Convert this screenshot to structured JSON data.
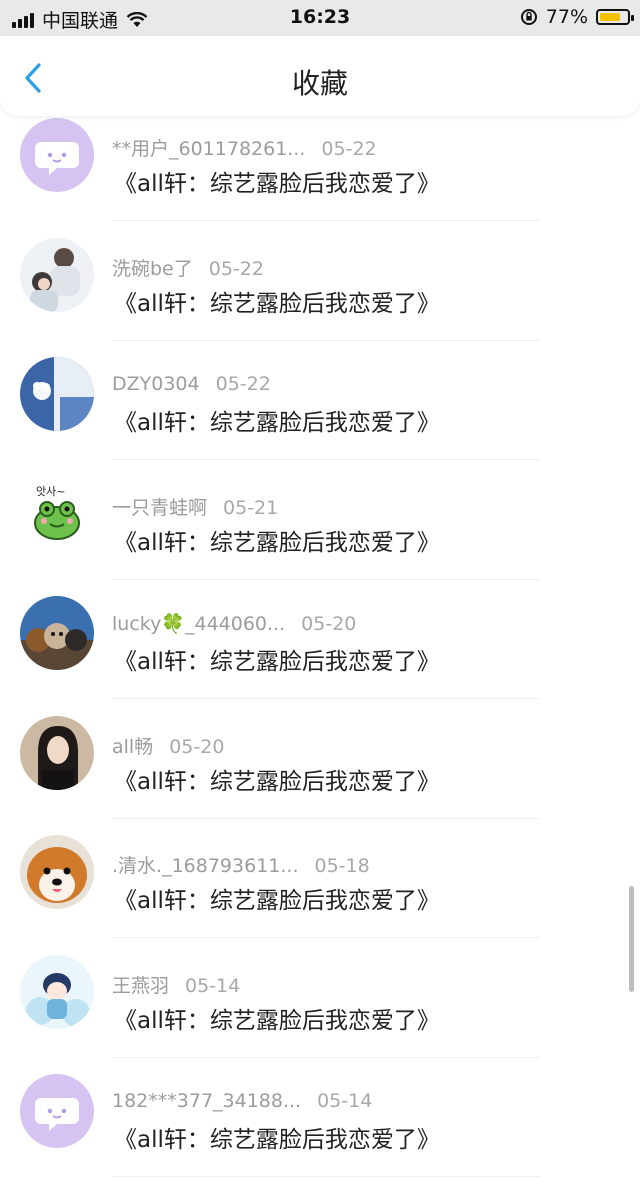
{
  "status_bar": {
    "carrier": "中国联通",
    "time": "16:23",
    "battery": "77%",
    "battery_level": 0.77
  },
  "nav": {
    "title": "收藏"
  },
  "items": [
    {
      "user": "**用户_601178261...",
      "date": "05-22",
      "book": "《all轩：综艺露脸后我恋爱了》",
      "avatar": "default-chat-avatar"
    },
    {
      "user": "洗碗be了",
      "date": "05-22",
      "book": "《all轩：综艺露脸后我恋爱了》",
      "avatar": "photo-avatar-couple"
    },
    {
      "user": "DZY0304",
      "date": "05-22",
      "book": "《all轩：综艺露脸后我恋爱了》",
      "avatar": "photo-avatar-blue"
    },
    {
      "user": "一只青蛙啊",
      "date": "05-21",
      "book": "《all轩：综艺露脸后我恋爱了》",
      "avatar": "frog-avatar",
      "avatar_text": "앗사~"
    },
    {
      "user": "lucky🍀_444060...",
      "date": "05-20",
      "book": "《all轩：综艺露脸后我恋爱了》",
      "avatar": "photo-avatar-pets"
    },
    {
      "user": "all畅",
      "date": "05-20",
      "book": "《all轩：综艺露脸后我恋爱了》",
      "avatar": "photo-avatar-portrait"
    },
    {
      "user": ".清水._168793611...",
      "date": "05-18",
      "book": "《all轩：综艺露脸后我恋爱了》",
      "avatar": "photo-avatar-dog"
    },
    {
      "user": "王燕羽",
      "date": "05-14",
      "book": "《all轩：综艺露脸后我恋爱了》",
      "avatar": "illustration-avatar"
    },
    {
      "user": "182***377_34188...",
      "date": "05-14",
      "book": "《all轩：综艺露脸后我恋爱了》",
      "avatar": "default-chat-avatar"
    }
  ]
}
